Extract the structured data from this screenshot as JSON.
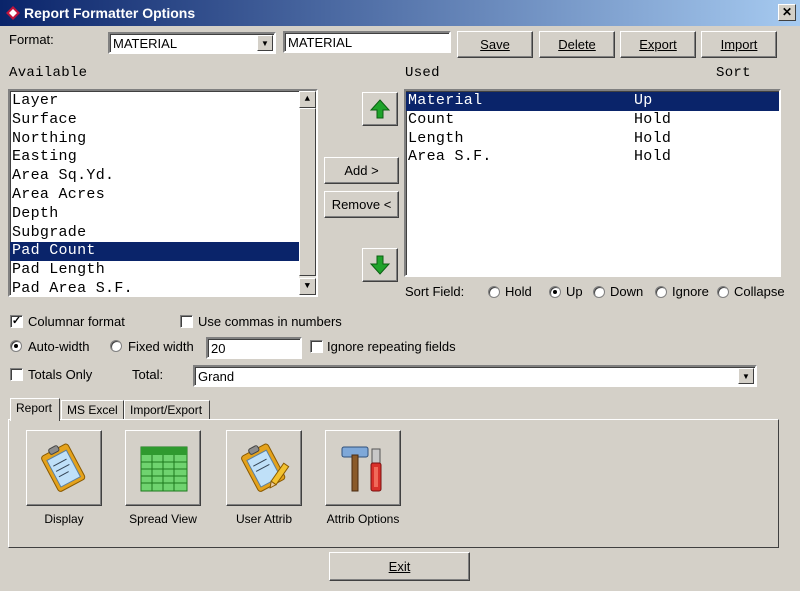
{
  "window": {
    "title": "Report Formatter Options",
    "close": "✕"
  },
  "format": {
    "label": "Format:",
    "selected": "MATERIAL",
    "name_value": "MATERIAL"
  },
  "toolbar": {
    "save": "Save",
    "delete": "Delete",
    "export": "Export",
    "import": "Import"
  },
  "available": {
    "header": "Available",
    "items": [
      "Layer",
      "Surface",
      "Northing",
      "Easting",
      "Area Sq.Yd.",
      "Area Acres",
      "Depth",
      "Subgrade",
      "Pad Count",
      "Pad Length",
      "Pad Area S.F."
    ],
    "selected_index": 8
  },
  "move": {
    "add": "Add >",
    "remove": "Remove <"
  },
  "used": {
    "header": "Used",
    "sort_header": "Sort",
    "rows": [
      {
        "field": "Material",
        "sort": "Up"
      },
      {
        "field": "Count",
        "sort": "Hold"
      },
      {
        "field": "Length",
        "sort": "Hold"
      },
      {
        "field": "Area S.F.",
        "sort": "Hold"
      }
    ],
    "selected_index": 0
  },
  "sort_field": {
    "label": "Sort Field:",
    "options": [
      "Hold",
      "Up",
      "Down",
      "Ignore",
      "Collapse"
    ],
    "selected": "Up"
  },
  "options": {
    "columnar_format": {
      "label": "Columnar format",
      "checked": true
    },
    "use_commas": {
      "label": "Use commas in numbers",
      "checked": false
    },
    "auto_width": {
      "label": "Auto-width",
      "selected": true
    },
    "fixed_width": {
      "label": "Fixed width",
      "selected": false,
      "value": "20"
    },
    "ignore_repeating": {
      "label": "Ignore repeating fields",
      "checked": false
    },
    "totals_only": {
      "label": "Totals Only",
      "checked": false
    },
    "total": {
      "label": "Total:",
      "selected": "Grand"
    }
  },
  "tabs": [
    "Report",
    "MS Excel",
    "Import/Export"
  ],
  "active_tab": "Report",
  "tools": [
    {
      "label": "Display",
      "icon": "clipboard-icon"
    },
    {
      "label": "Spread View",
      "icon": "spreadsheet-icon"
    },
    {
      "label": "User Attrib",
      "icon": "clipboard-edit-icon"
    },
    {
      "label": "Attrib Options",
      "icon": "tools-icon"
    }
  ],
  "exit": "Exit",
  "colors": {
    "title_start": "#0a246a",
    "title_end": "#a6caf0",
    "selection": "#0a246a",
    "arrow_green": "#1fa32b",
    "face": "#d4d0c8"
  }
}
